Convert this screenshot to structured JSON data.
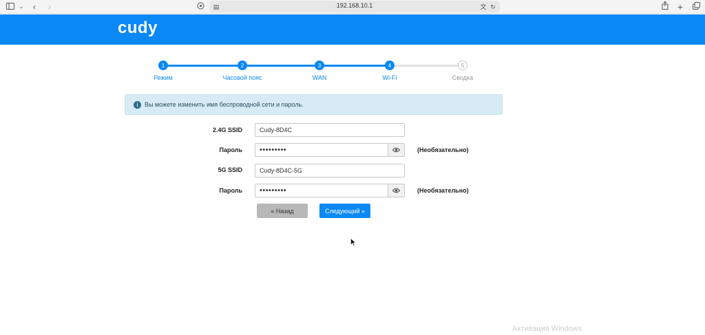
{
  "browser": {
    "address": "192.168.10.1"
  },
  "header": {
    "logo": "cudy",
    "brand_color": "#0a88f5"
  },
  "stepper": {
    "steps": [
      {
        "number": "1",
        "label": "Режим",
        "state": "done"
      },
      {
        "number": "2",
        "label": "Часовой пояс",
        "state": "done"
      },
      {
        "number": "3",
        "label": "WAN",
        "state": "done"
      },
      {
        "number": "4",
        "label": "Wi-Fi",
        "state": "current"
      },
      {
        "number": "5",
        "label": "Сводка",
        "state": "todo"
      }
    ]
  },
  "info": {
    "icon": "info-icon",
    "text": "Вы можете изменить имя беспроводной сети и пароль."
  },
  "form": {
    "ssid_24_label": "2.4G SSID",
    "ssid_24_value": "Cudy-8D4C",
    "password_24_label": "Пароль",
    "password_24_value": "•••••••••",
    "password_24_hint": "(Необязательно)",
    "ssid_5_label": "5G SSID",
    "ssid_5_value": "Cudy-8D4C-5G",
    "password_5_label": "Пароль",
    "password_5_value": "•••••••••",
    "password_5_hint": "(Необязательно)"
  },
  "buttons": {
    "back": "« Назад",
    "next": "Следующий »"
  },
  "watermark": "Активация Windows"
}
